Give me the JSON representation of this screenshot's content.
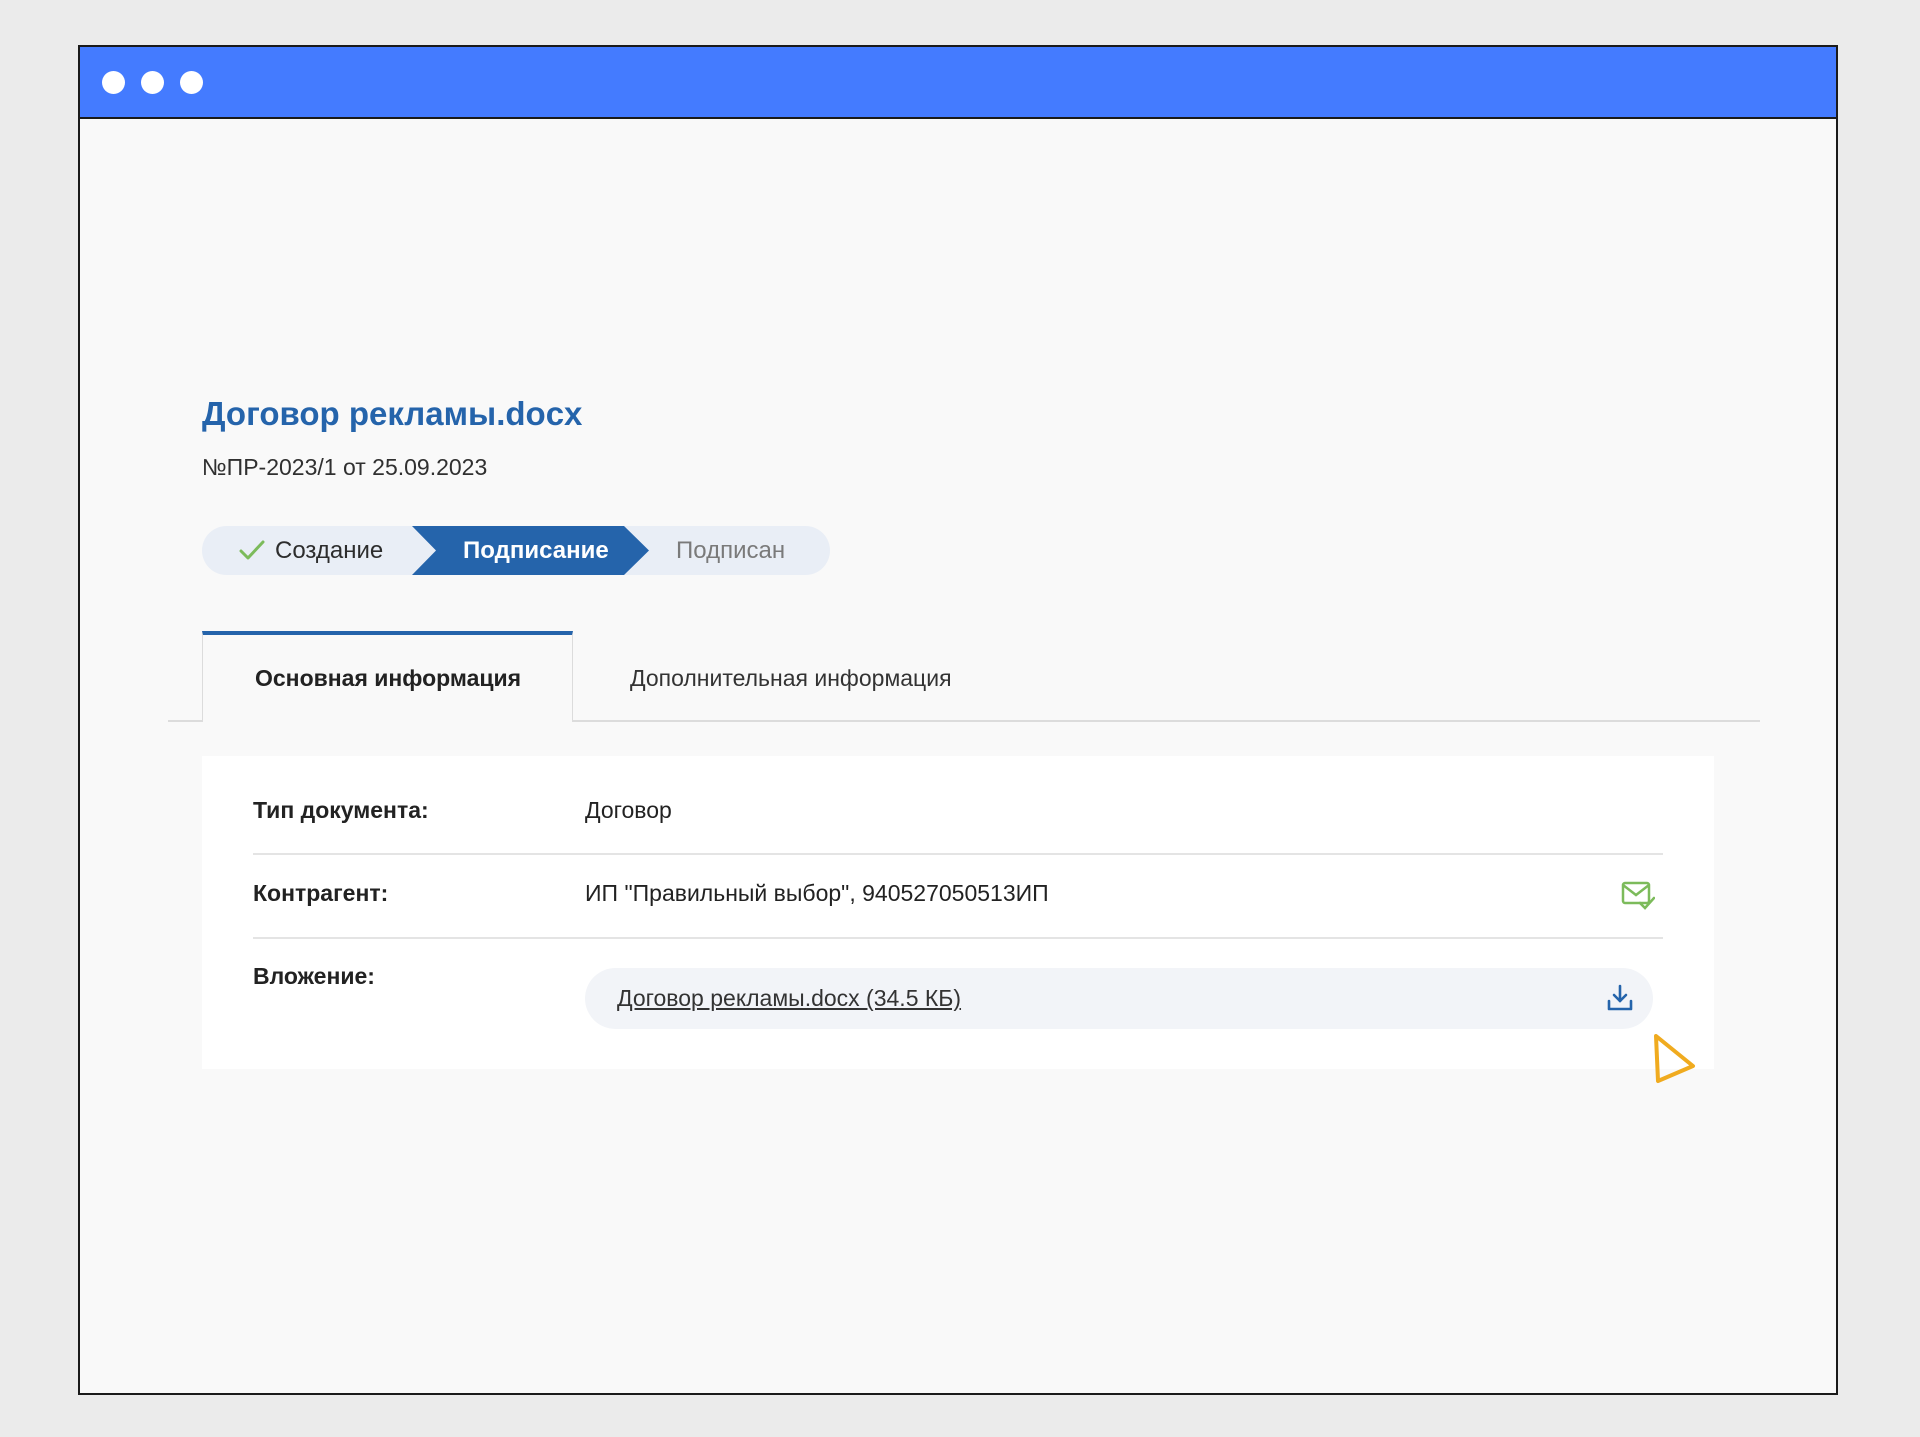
{
  "document": {
    "title": "Договор рекламы.docx",
    "number": "№ПР-2023/1 от 25.09.2023"
  },
  "stepper": {
    "steps": [
      {
        "label": "Создание",
        "state": "done"
      },
      {
        "label": "Подписание",
        "state": "current"
      },
      {
        "label": "Подписан",
        "state": "pending"
      }
    ]
  },
  "tabs": [
    {
      "label": "Основная информация",
      "active": true
    },
    {
      "label": "Дополнительная информация",
      "active": false
    }
  ],
  "info": {
    "doc_type": {
      "label": "Тип документа:",
      "value": "Договор"
    },
    "counterparty": {
      "label": "Контрагент:",
      "value": "ИП \"Правильный выбор\", 940527050513ИП"
    },
    "attachment": {
      "label": "Вложение:",
      "link": "Договор рекламы.docx (34.5 КБ)"
    }
  },
  "colors": {
    "titlebar": "#447bff",
    "accent": "#2564ab",
    "success": "#7cbb5b",
    "cursor": "#f0ab1f"
  },
  "icons": {
    "check": "check-icon",
    "mail_verified": "mail-check-icon",
    "download": "download-icon",
    "cursor": "cursor-pointer-icon"
  }
}
